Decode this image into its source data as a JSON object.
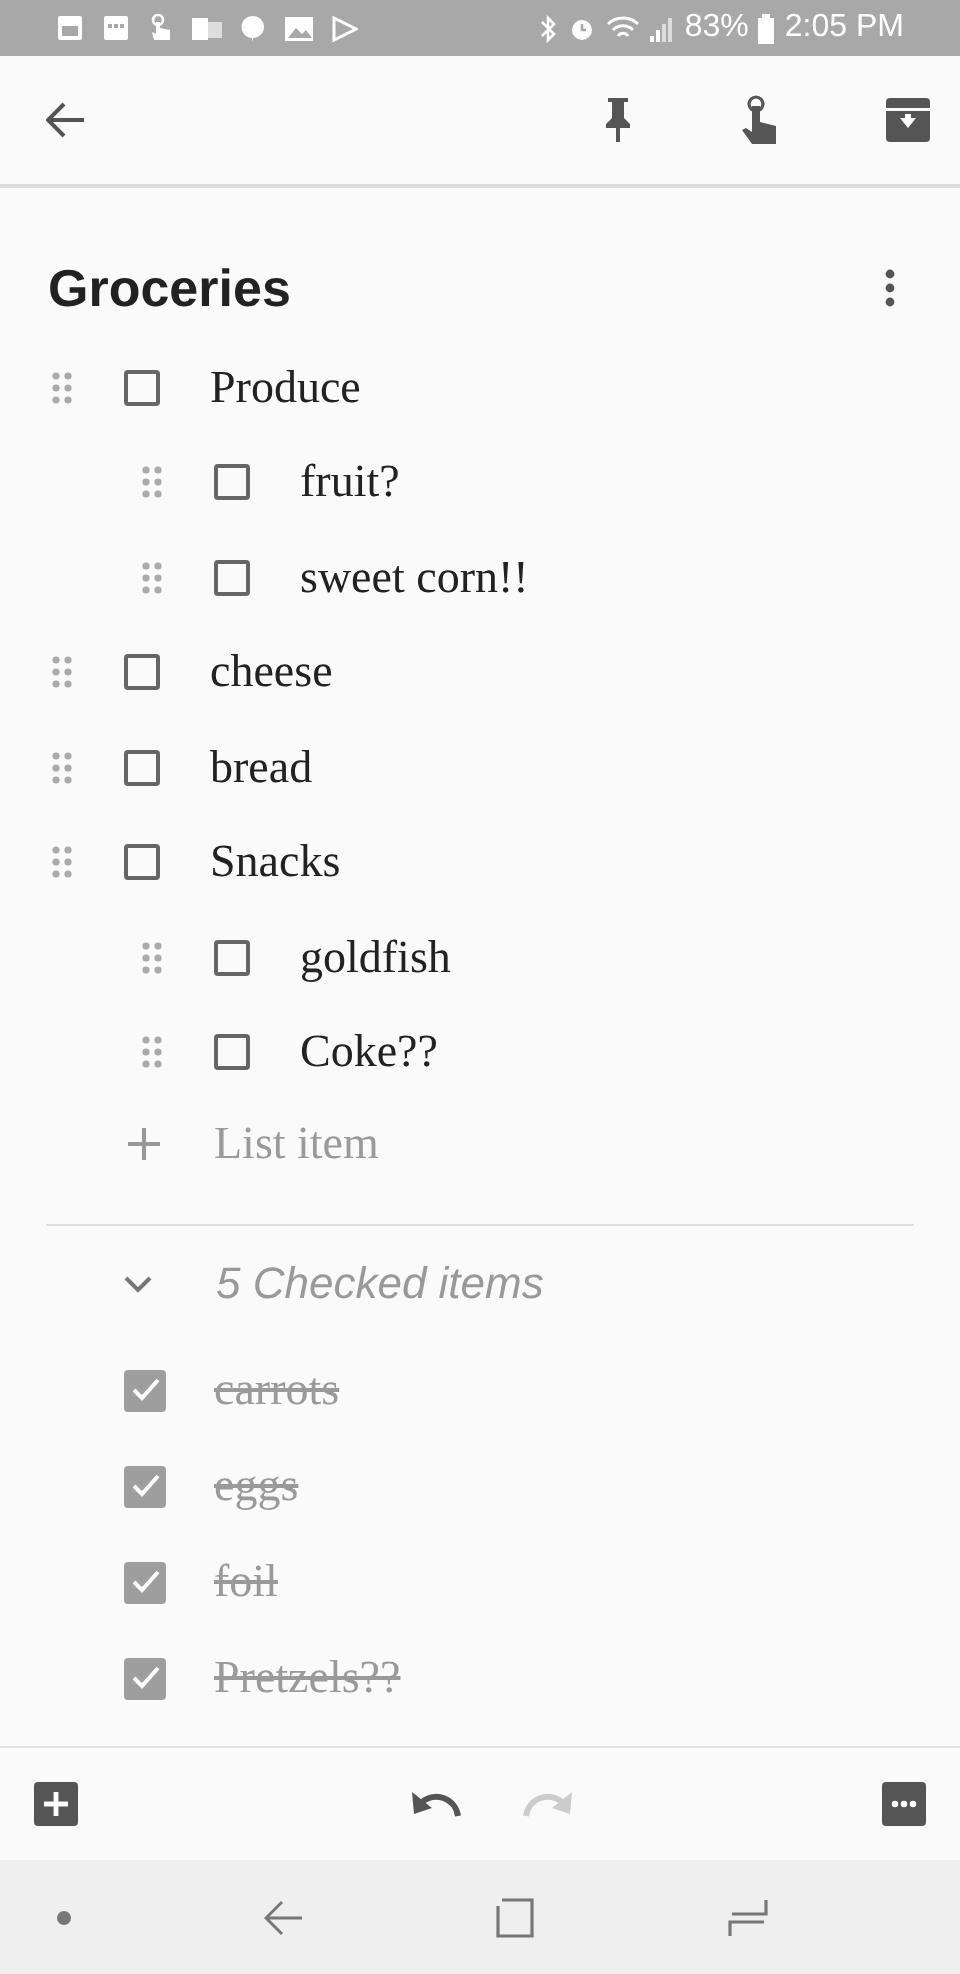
{
  "status_bar": {
    "battery": "83%",
    "time": "2:05 PM"
  },
  "note": {
    "title": "Groceries",
    "items": [
      {
        "text": "Produce",
        "checked": false,
        "children": [
          {
            "text": "fruit?",
            "checked": false
          },
          {
            "text": "sweet corn!!",
            "checked": false
          }
        ]
      },
      {
        "text": "cheese",
        "checked": false
      },
      {
        "text": "bread",
        "checked": false
      },
      {
        "text": "Snacks",
        "checked": false,
        "children": [
          {
            "text": "goldfish",
            "checked": false
          },
          {
            "text": "Coke??",
            "checked": false
          }
        ]
      }
    ],
    "add_item": {
      "placeholder": "List item"
    },
    "checked_section": {
      "label": "5 Checked items",
      "expanded": true,
      "items": [
        {
          "text": "carrots",
          "checked": true
        },
        {
          "text": "eggs",
          "checked": true
        },
        {
          "text": "foil",
          "checked": true
        },
        {
          "text": "Pretzels??",
          "checked": true
        }
      ]
    }
  },
  "bottom_bar": {
    "redo_disabled": true
  }
}
